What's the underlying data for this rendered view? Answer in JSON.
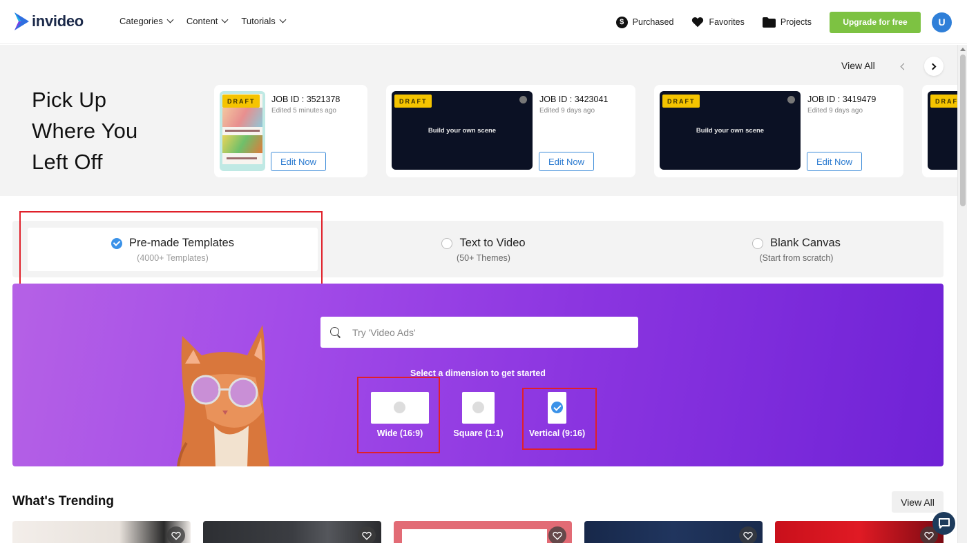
{
  "brand": {
    "name": "invideo"
  },
  "nav": {
    "menu": [
      {
        "label": "Categories"
      },
      {
        "label": "Content"
      },
      {
        "label": "Tutorials"
      }
    ],
    "purchased": "Purchased",
    "favorites": "Favorites",
    "projects": "Projects",
    "upgrade": "Upgrade for free",
    "avatar_initial": "U"
  },
  "drafts": {
    "heading": [
      "Pick Up",
      "Where You",
      "Left Off"
    ],
    "view_all": "View All",
    "badge": "DRAFT",
    "cards": [
      {
        "job_id": "JOB ID : 3521378",
        "edited": "Edited 5 minutes ago",
        "button": "Edit Now",
        "thumb_text": ""
      },
      {
        "job_id": "JOB ID : 3423041",
        "edited": "Edited 9 days ago",
        "button": "Edit Now",
        "thumb_text": "Build your own scene"
      },
      {
        "job_id": "JOB ID : 3419479",
        "edited": "Edited 9 days ago",
        "button": "Edit Now",
        "thumb_text": "Build your own scene"
      }
    ]
  },
  "options": [
    {
      "label": "Pre-made Templates",
      "sub": "(4000+ Templates)",
      "selected": true
    },
    {
      "label": "Text to Video",
      "sub": "(50+ Themes)",
      "selected": false
    },
    {
      "label": "Blank Canvas",
      "sub": "(Start from scratch)",
      "selected": false
    }
  ],
  "hero": {
    "search_placeholder": "Try 'Video Ads'",
    "dimension_title": "Select a dimension to get started",
    "dimensions": [
      {
        "label": "Wide (16:9)",
        "selected": false
      },
      {
        "label": "Square (1:1)",
        "selected": false
      },
      {
        "label": "Vertical (9:16)",
        "selected": true
      }
    ]
  },
  "trending": {
    "title": "What's Trending",
    "view_all": "View All"
  },
  "colors": {
    "accent_green": "#7dc242",
    "accent_blue": "#3b92e8",
    "highlight_red": "#e0202a",
    "draft_yellow": "#f5c400",
    "hero_purple": "#8b35e0"
  }
}
